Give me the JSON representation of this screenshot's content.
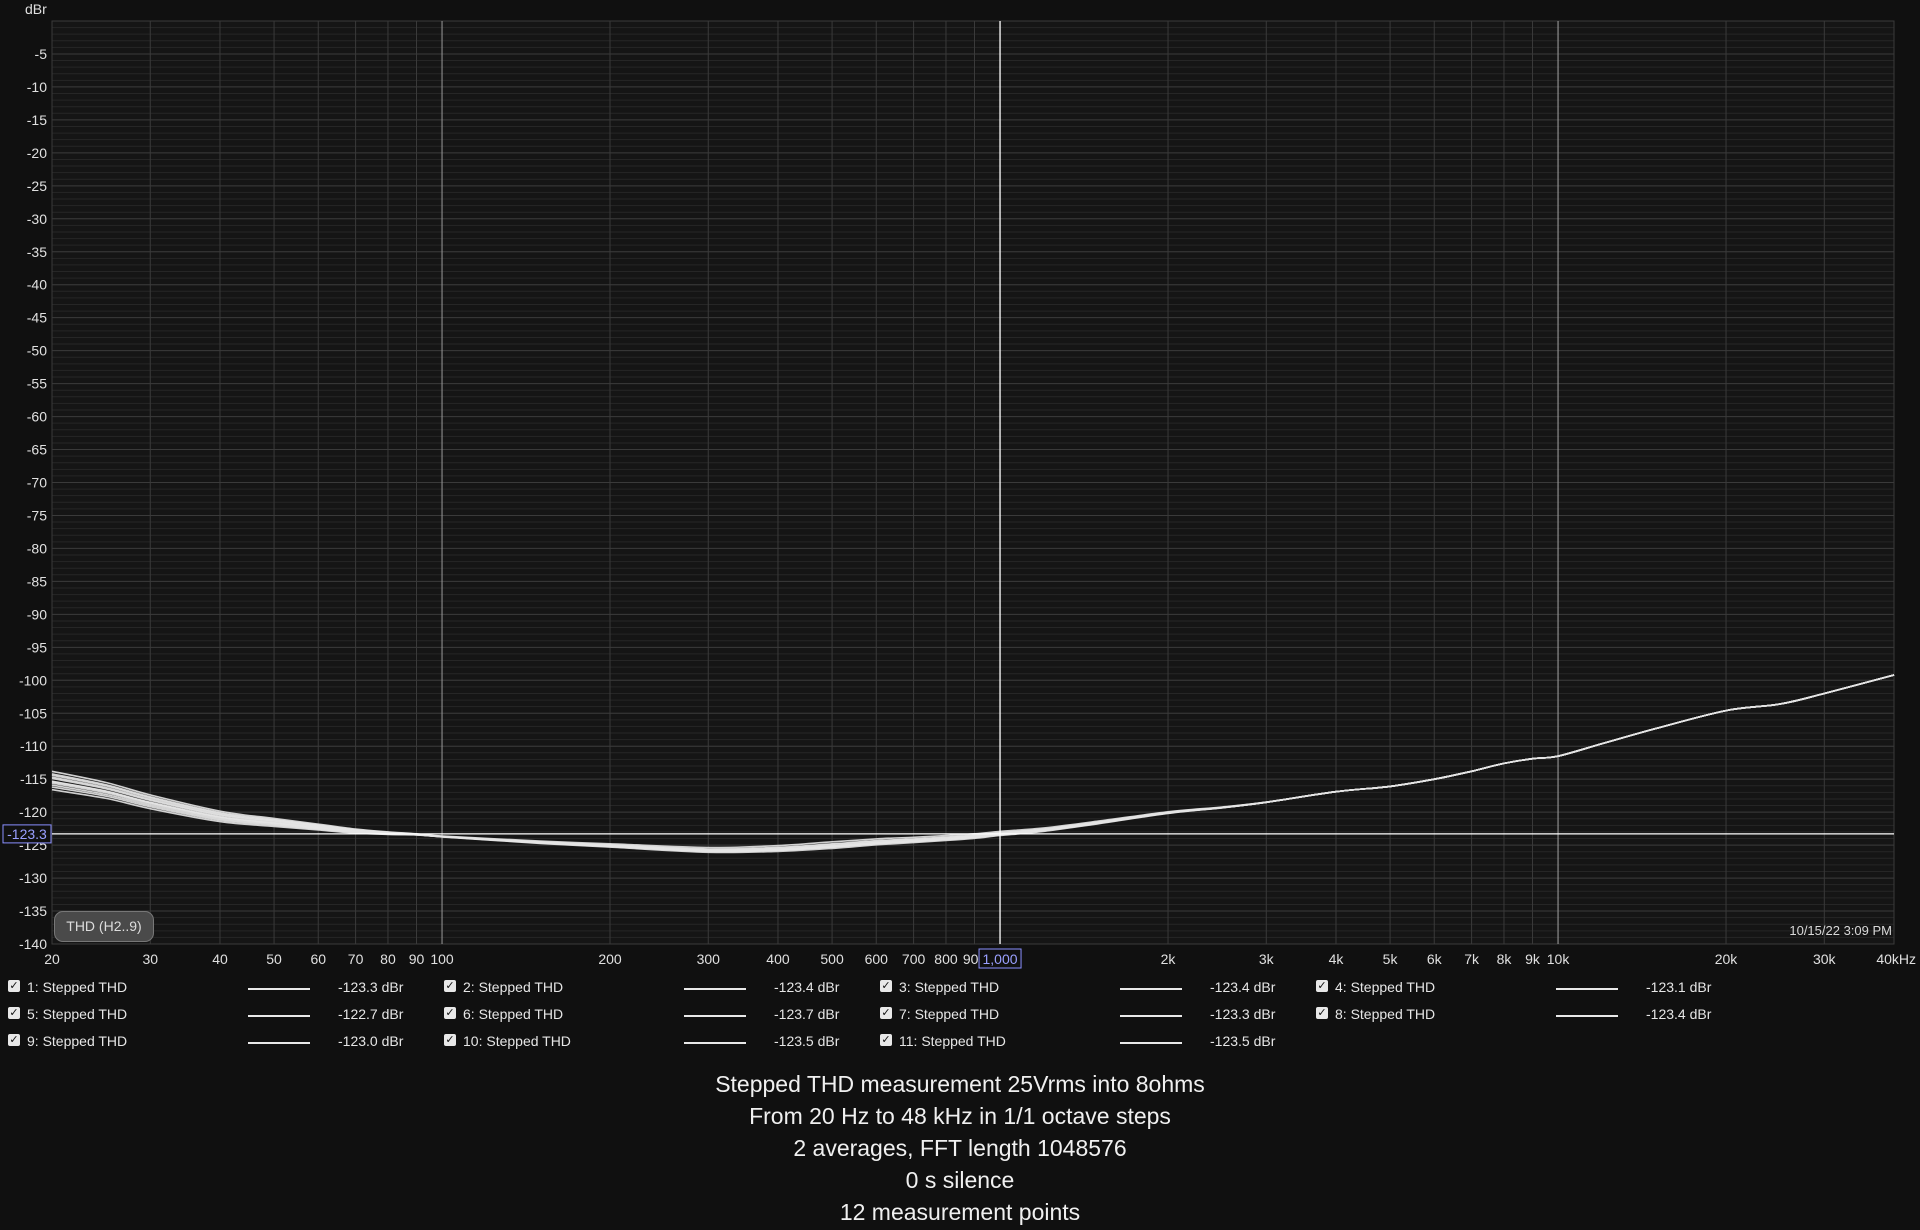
{
  "plot": {
    "y_unit": "dBr",
    "timestamp": "10/15/22 3:09 PM",
    "cursor_y_label": "-123.3",
    "cursor_x_label": "1,000",
    "badge": "THD (H2..9)"
  },
  "legend": [
    {
      "name": "1: Stepped THD",
      "value": "-123.3 dBr"
    },
    {
      "name": "2: Stepped THD",
      "value": "-123.4 dBr"
    },
    {
      "name": "3: Stepped THD",
      "value": "-123.4 dBr"
    },
    {
      "name": "4: Stepped THD",
      "value": "-123.1 dBr"
    },
    {
      "name": "5: Stepped THD",
      "value": "-122.7 dBr"
    },
    {
      "name": "6: Stepped THD",
      "value": "-123.7 dBr"
    },
    {
      "name": "7: Stepped THD",
      "value": "-123.3 dBr"
    },
    {
      "name": "8: Stepped THD",
      "value": "-123.4 dBr"
    },
    {
      "name": "9: Stepped THD",
      "value": "-123.0 dBr"
    },
    {
      "name": "10: Stepped THD",
      "value": "-123.5 dBr"
    },
    {
      "name": "11: Stepped THD",
      "value": "-123.5 dBr"
    }
  ],
  "description": [
    "Stepped THD measurement 25Vrms into 8ohms",
    "From 20 Hz to 48 kHz in 1/1 octave steps",
    "2 averages, FFT length 1048576",
    "0 s silence",
    "12 measurement points"
  ],
  "colors": {
    "background": "#101010",
    "plot_background": "#151515",
    "trace": "#e4e4e4",
    "cursor_box": "#8a8fff"
  },
  "chart_data": {
    "type": "line",
    "x_scale": "log",
    "xlim": [
      20,
      40000
    ],
    "ylim": [
      -140,
      0
    ],
    "ylabel": "dBr",
    "grid": true,
    "legend_position": "bottom",
    "y_ticks": [
      "-5",
      "-10",
      "-15",
      "-20",
      "-25",
      "-30",
      "-35",
      "-40",
      "-45",
      "-50",
      "-55",
      "-60",
      "-65",
      "-70",
      "-75",
      "-80",
      "-85",
      "-90",
      "-95",
      "-100",
      "-105",
      "-110",
      "-115",
      "-120",
      "-125",
      "-130",
      "-135",
      "-140"
    ],
    "x_ticks": [
      {
        "v": 20,
        "label": "20"
      },
      {
        "v": 30,
        "label": "30"
      },
      {
        "v": 40,
        "label": "40"
      },
      {
        "v": 50,
        "label": "50"
      },
      {
        "v": 60,
        "label": "60"
      },
      {
        "v": 70,
        "label": "70"
      },
      {
        "v": 80,
        "label": "80"
      },
      {
        "v": 90,
        "label": "90"
      },
      {
        "v": 100,
        "label": "100"
      },
      {
        "v": 200,
        "label": "200"
      },
      {
        "v": 300,
        "label": "300"
      },
      {
        "v": 400,
        "label": "400"
      },
      {
        "v": 500,
        "label": "500"
      },
      {
        "v": 600,
        "label": "600"
      },
      {
        "v": 700,
        "label": "700"
      },
      {
        "v": 800,
        "label": "800"
      },
      {
        "v": 900,
        "label": "900"
      },
      {
        "v": 2000,
        "label": "2k"
      },
      {
        "v": 3000,
        "label": "3k"
      },
      {
        "v": 4000,
        "label": "4k"
      },
      {
        "v": 5000,
        "label": "5k"
      },
      {
        "v": 6000,
        "label": "6k"
      },
      {
        "v": 7000,
        "label": "7k"
      },
      {
        "v": 8000,
        "label": "8k"
      },
      {
        "v": 9000,
        "label": "9k"
      },
      {
        "v": 10000,
        "label": "10k"
      },
      {
        "v": 20000,
        "label": "20k"
      },
      {
        "v": 30000,
        "label": "30k"
      },
      {
        "v": 40000,
        "label": "40kHz"
      }
    ],
    "cursor": {
      "x": 1000,
      "y": -123.3
    },
    "base_curve": {
      "x": [
        20,
        25,
        30,
        40,
        50,
        60,
        70,
        80,
        90,
        100,
        150,
        200,
        300,
        400,
        500,
        600,
        700,
        800,
        900,
        1000,
        1200,
        1500,
        2000,
        2500,
        3000,
        4000,
        5000,
        6000,
        7000,
        8000,
        9000,
        10000,
        12000,
        15000,
        20000,
        25000,
        30000,
        40000
      ],
      "y": [
        -115.3,
        -116.8,
        -118.5,
        -120.7,
        -121.6,
        -122.3,
        -122.9,
        -123.2,
        -123.4,
        -123.7,
        -124.6,
        -125.1,
        -125.8,
        -125.6,
        -125.1,
        -124.6,
        -124.3,
        -124.0,
        -123.7,
        -123.3,
        -122.7,
        -121.6,
        -120.1,
        -119.3,
        -118.5,
        -116.9,
        -116.1,
        -115.0,
        -113.8,
        -112.6,
        -111.9,
        -111.5,
        -109.6,
        -107.3,
        -104.6,
        -103.6,
        -102.0,
        -99.2
      ]
    },
    "series": [
      {
        "name": "1: Stepped THD",
        "low_freq_offset": 0.0,
        "mid_offset": 0.0
      },
      {
        "name": "2: Stepped THD",
        "low_freq_offset": 0.9,
        "mid_offset": -0.2
      },
      {
        "name": "3: Stepped THD",
        "low_freq_offset": -0.6,
        "mid_offset": -0.2
      },
      {
        "name": "4: Stepped THD",
        "low_freq_offset": 1.5,
        "mid_offset": 0.2
      },
      {
        "name": "5: Stepped THD",
        "low_freq_offset": -1.3,
        "mid_offset": 0.6
      },
      {
        "name": "6: Stepped THD",
        "low_freq_offset": 0.4,
        "mid_offset": -0.4
      },
      {
        "name": "7: Stepped THD",
        "low_freq_offset": -0.3,
        "mid_offset": 0.0
      },
      {
        "name": "8: Stepped THD",
        "low_freq_offset": 1.1,
        "mid_offset": -0.1
      },
      {
        "name": "9: Stepped THD",
        "low_freq_offset": -0.9,
        "mid_offset": 0.3
      },
      {
        "name": "10: Stepped THD",
        "low_freq_offset": 0.6,
        "mid_offset": -0.2
      },
      {
        "name": "11: Stepped THD",
        "low_freq_offset": -0.1,
        "mid_offset": -0.2
      }
    ]
  }
}
